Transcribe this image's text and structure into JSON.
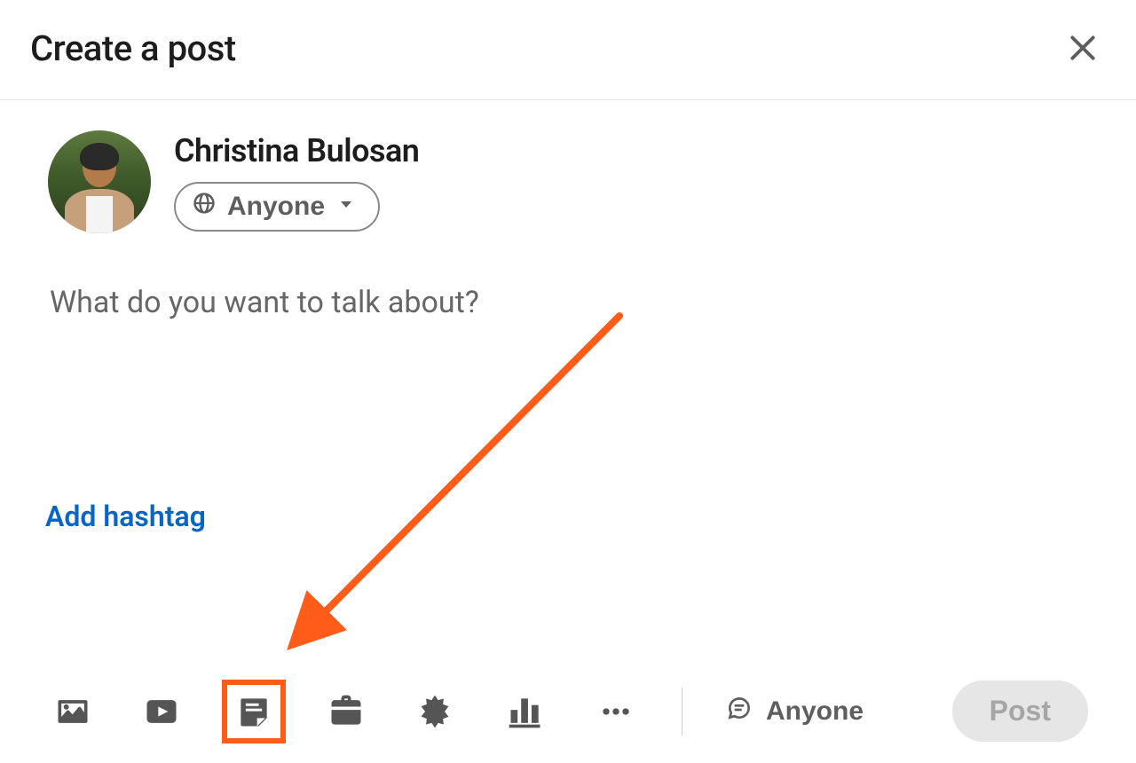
{
  "modal": {
    "title": "Create a post"
  },
  "author": {
    "name": "Christina Bulosan"
  },
  "audience": {
    "label": "Anyone"
  },
  "composer": {
    "placeholder": "What do you want to talk about?",
    "value": ""
  },
  "actions": {
    "hashtag_label": "Add hashtag",
    "post_label": "Post"
  },
  "comment_scope": {
    "label": "Anyone"
  },
  "annotation": {
    "color": "#ff5c1a"
  }
}
